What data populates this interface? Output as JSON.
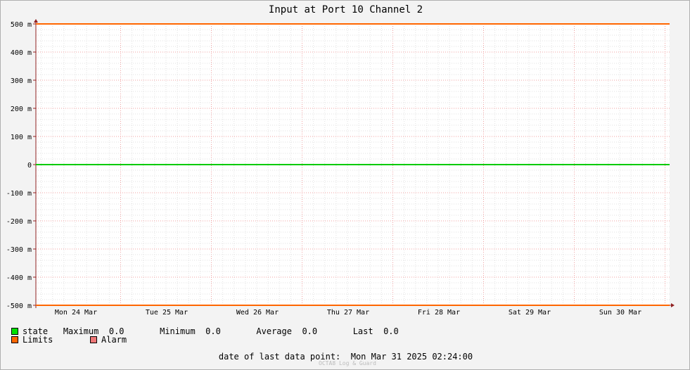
{
  "chart_data": {
    "type": "line",
    "title": "Input at Port 10 Channel 2",
    "xlabel": "",
    "ylabel": "",
    "x_tick_labels": [
      "Mon 24 Mar",
      "Tue 25 Mar",
      "Wed 26 Mar",
      "Thu 27 Mar",
      "Fri 28 Mar",
      "Sat 29 Mar",
      "Sun 30 Mar"
    ],
    "y_ticks": [
      500,
      400,
      300,
      200,
      100,
      0,
      -100,
      -200,
      -300,
      -400,
      -500
    ],
    "y_tick_labels": [
      "500 m",
      "400 m",
      "300 m",
      "200 m",
      "100 m",
      "0",
      "-100 m",
      "-200 m",
      "-300 m",
      "-400 m",
      "-500 m"
    ],
    "ylim": [
      -500,
      500
    ],
    "grid": true,
    "series": [
      {
        "name": "state",
        "color": "#00cc00",
        "values": [
          0,
          0,
          0,
          0,
          0,
          0,
          0,
          0
        ]
      },
      {
        "name": "Limits",
        "color": "#ff6600",
        "values": [
          500,
          500,
          500,
          500,
          500,
          500,
          500,
          500
        ]
      },
      {
        "name": "Limits",
        "color": "#ff6600",
        "values": [
          -500,
          -500,
          -500,
          -500,
          -500,
          -500,
          -500,
          -500
        ]
      }
    ]
  },
  "legend": {
    "state": {
      "label": "state",
      "color": "#00e000",
      "max_label": "Maximum",
      "max_value": "0.0",
      "min_label": "Minimum",
      "min_value": "0.0",
      "avg_label": "Average",
      "avg_value": "0.0",
      "last_label": "Last",
      "last_value": "0.0"
    },
    "limits": {
      "label": "Limits",
      "color": "#ff6600"
    },
    "alarm": {
      "label": "Alarm",
      "color": "#ee7777"
    }
  },
  "footer": {
    "date_label": "date of last data point:",
    "date_value": "Mon Mar 31 2025 02:24:00",
    "watermark": "OCTA8 Log & Guard"
  }
}
